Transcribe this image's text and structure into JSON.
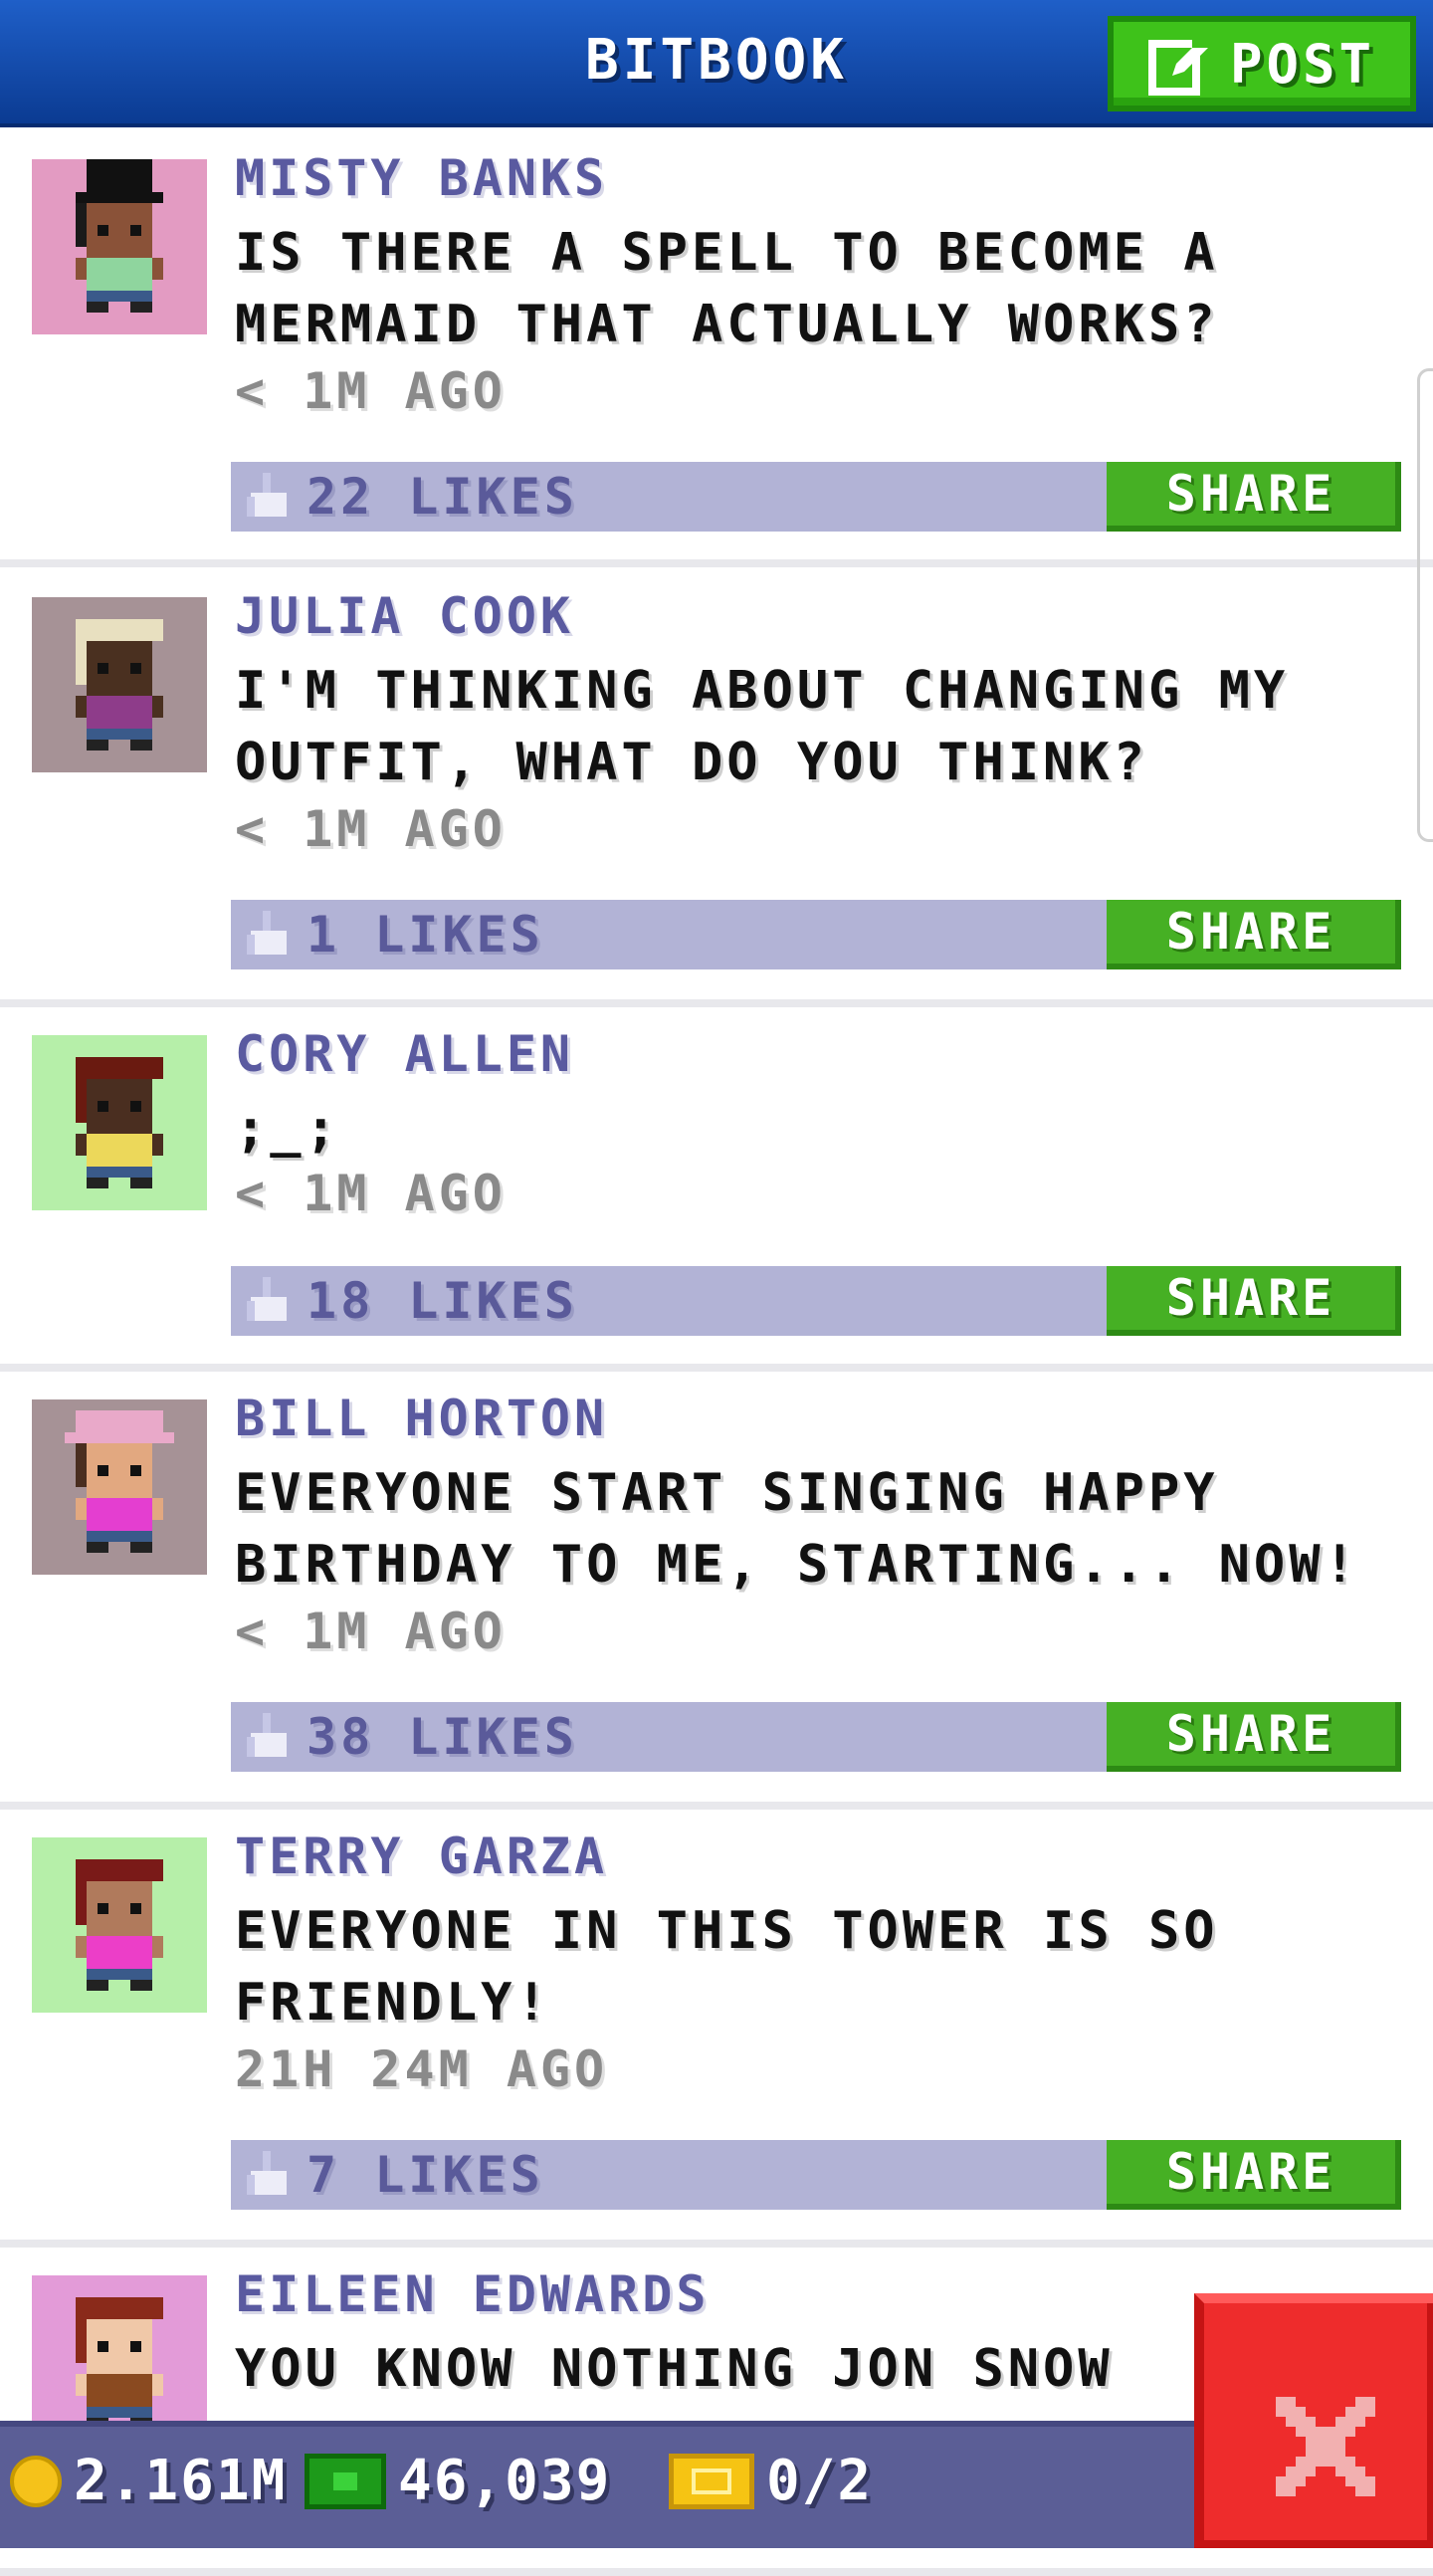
{
  "header": {
    "title": "BITBOOK",
    "post_label": "POST"
  },
  "posts": [
    {
      "name": "MISTY BANKS",
      "message": "IS THERE A SPELL TO BECOME A\nMERMAID THAT ACTUALLY WORKS?",
      "time": "< 1M AGO",
      "likes": "22 LIKES",
      "share": "SHARE",
      "avatar_bg": "#e39bc2",
      "skin": "#8a5238",
      "shirt": "#8fd59e",
      "hair": "#1a1a1a",
      "hat": "top-hat"
    },
    {
      "name": "JULIA COOK",
      "message": "I'M THINKING ABOUT CHANGING MY\nOUTFIT, WHAT DO YOU THINK?",
      "time": "< 1M AGO",
      "likes": "1 LIKES",
      "share": "SHARE",
      "avatar_bg": "#a69296",
      "skin": "#4a3020",
      "shirt": "#8e3c8a",
      "hair": "#e8e0c0",
      "hat": "none"
    },
    {
      "name": "CORY ALLEN",
      "message": ";_;",
      "time": "< 1M AGO",
      "likes": "18 LIKES",
      "share": "SHARE",
      "avatar_bg": "#b6efa9",
      "skin": "#4a2e20",
      "shirt": "#ecd85a",
      "hair": "#6a1a10",
      "hat": "none"
    },
    {
      "name": "BILL HORTON",
      "message": "EVERYONE START SINGING HAPPY\nBIRTHDAY TO ME, STARTING... NOW!",
      "time": "< 1M AGO",
      "likes": "38 LIKES",
      "share": "SHARE",
      "avatar_bg": "#a69296",
      "skin": "#e2a880",
      "shirt": "#e43ed0",
      "hair": "#4a2e20",
      "hat": "cap"
    },
    {
      "name": "TERRY GARZA",
      "message": "EVERYONE IN THIS TOWER IS SO\nFRIENDLY!",
      "time": "21H 24M AGO",
      "likes": "7 LIKES",
      "share": "SHARE",
      "avatar_bg": "#b6efa9",
      "skin": "#b07a5c",
      "shirt": "#ec3ec8",
      "hair": "#7a1a18",
      "hat": "none"
    },
    {
      "name": "EILEEN EDWARDS",
      "message": "YOU KNOW NOTHING JON SNOW",
      "time": "",
      "likes": "",
      "share": "",
      "avatar_bg": "#e39bd8",
      "skin": "#f0c8a8",
      "shirt": "#8a4a20",
      "hair": "#8a2a1a",
      "hat": "none"
    }
  ],
  "bottom_bar": {
    "coins": "2.161M",
    "bux": "46,039",
    "tickets": "0/2"
  },
  "colors": {
    "header": "#0b3b92",
    "post_green": "#3ec21a",
    "likes_bar": "#b2b3d6",
    "share_green": "#46b024",
    "close_red": "#ee2c2c"
  }
}
